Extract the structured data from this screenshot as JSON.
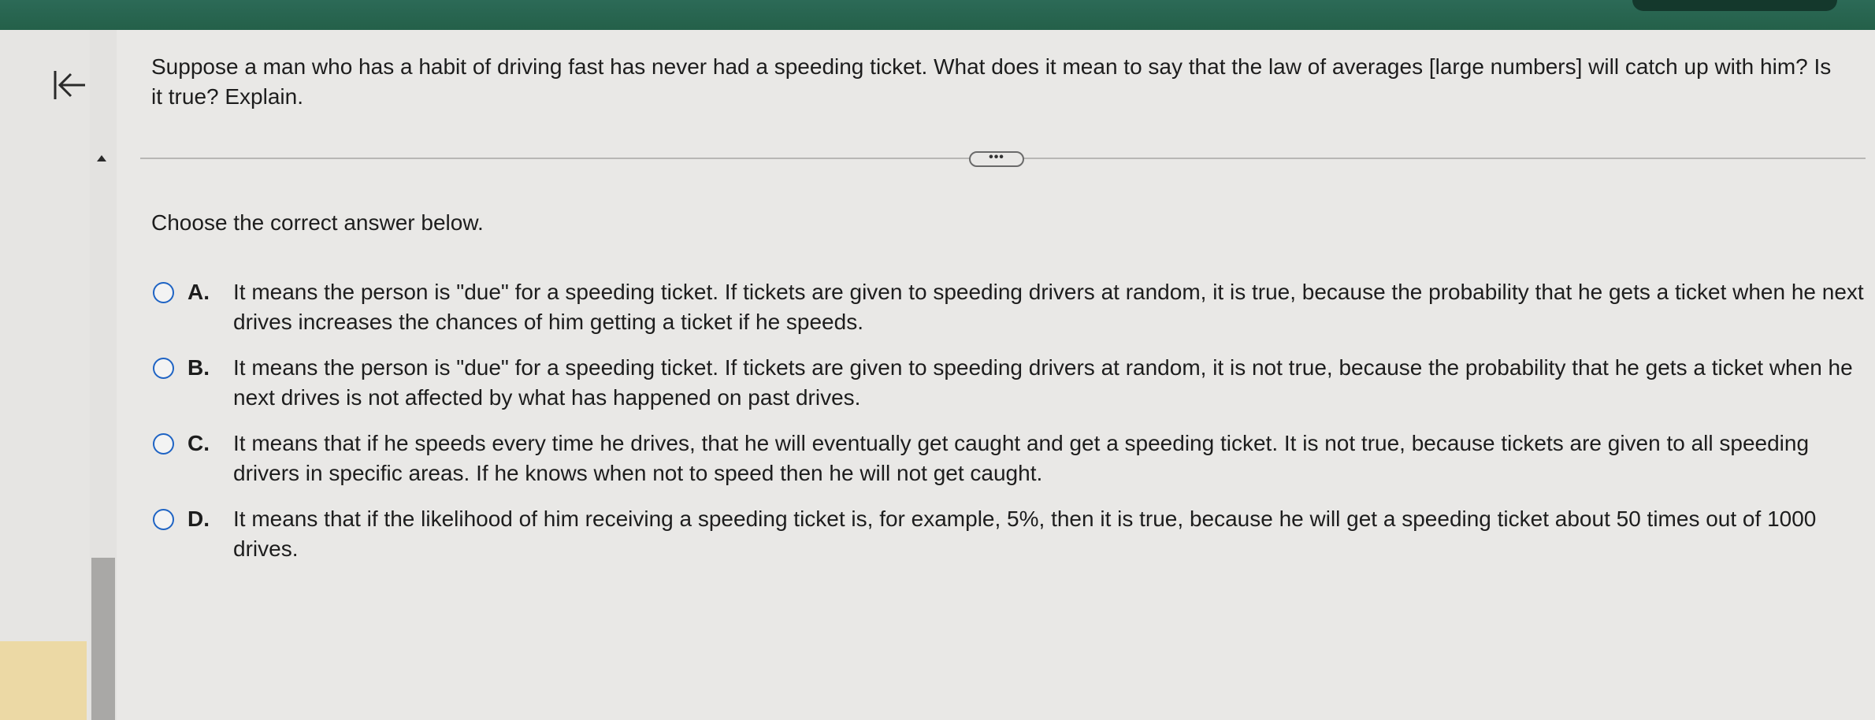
{
  "question": {
    "text": "Suppose a man who has a habit of driving fast has never had a speeding ticket. What does it mean to say that the law of averages [large numbers] will catch up with him? Is it true? Explain."
  },
  "more_button_label": "•••",
  "instruction": "Choose the correct answer below.",
  "options": [
    {
      "letter": "A.",
      "text": "It means the person is \"due\" for a speeding ticket. If tickets are given to speeding drivers at random, it is true, because the probability that he gets a ticket when he next drives increases the chances of him getting a ticket if he speeds."
    },
    {
      "letter": "B.",
      "text": "It means the person is \"due\" for a speeding ticket. If tickets are given to speeding drivers at random, it is not true, because the probability that he gets a ticket when he next drives is not affected by what has happened on past drives."
    },
    {
      "letter": "C.",
      "text": "It means that if he speeds every time he drives, that he will eventually get caught and get a speeding ticket. It is not true, because tickets are given to all speeding drivers in specific areas. If he knows when not to speed then he will not get caught."
    },
    {
      "letter": "D.",
      "text": "It means that if the likelihood of him receiving a speeding ticket is, for example, 5%, then it is true, because he will get a speeding ticket about 50 times out of 1000 drives."
    }
  ],
  "icons": {
    "collapse": "collapse-left-arrow-icon",
    "scroll_up": "triangle-up-icon"
  },
  "colors": {
    "header": "#2c6a57",
    "radio_border": "#1e63c4",
    "background": "#e9e8e6"
  }
}
